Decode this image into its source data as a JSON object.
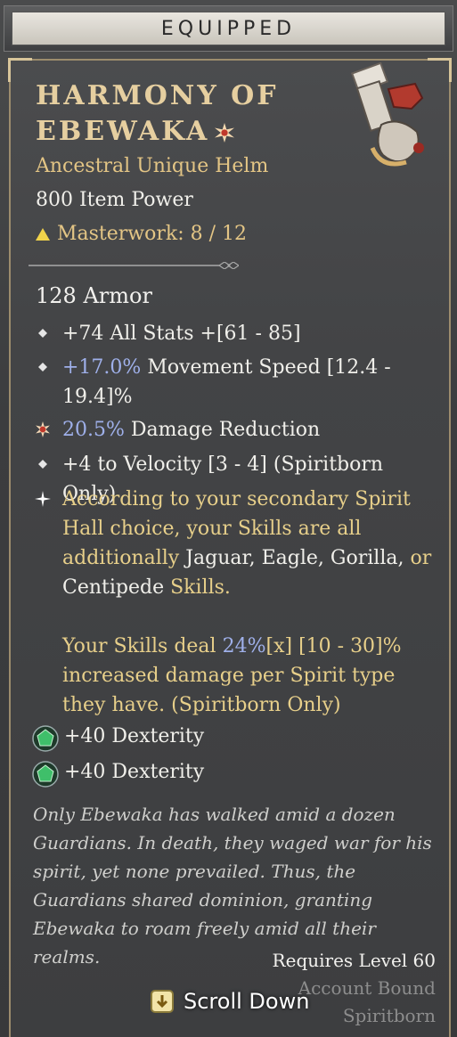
{
  "header": {
    "title": "EQUIPPED"
  },
  "item": {
    "name_line1": "HARMONY OF",
    "name_line2": "EBEWAKA",
    "rarity": "Ancestral Unique Helm",
    "item_power": "800 Item Power",
    "masterwork": "Masterwork: 8 / 12",
    "armor": "128 Armor"
  },
  "stats": [
    {
      "a": "+74 All Stats +[61 - 85]"
    },
    {
      "hl": "+17.0%",
      "a": " Movement Speed [12.4 - 19.4]%"
    },
    {
      "hl": "20.5%",
      "a": " Damage Reduction"
    },
    {
      "a": "+4 to Velocity [3 - 4] (Spiritborn Only)"
    }
  ],
  "unique": {
    "p1a": "According to your secondary Spirit Hall choice, your Skills are all additionally",
    "p1b": " Jaguar, Eagle, Gorilla,",
    "p1c": " or",
    "p1d": " Centipede",
    "p1e": " Skills.",
    "p2a": "Your Skills deal",
    "p2b": " 24%",
    "p2c": "[x] [10 - 30]%",
    "p2d": " increased damage per Spirit type they have. (Spiritborn Only)"
  },
  "gems": [
    {
      "text": "+40 Dexterity"
    },
    {
      "text": "+40 Dexterity"
    }
  ],
  "flavor": "Only Ebewaka has walked amid a dozen Guardians. In death, they waged war for his spirit, yet none prevailed. Thus, the Guardians shared dominion, granting Ebewaka to roam freely amid all their realms.",
  "footer": {
    "requires": "Requires Level 60",
    "bound": "Account Bound",
    "class": "Spiritborn",
    "scroll": "Scroll Down"
  }
}
